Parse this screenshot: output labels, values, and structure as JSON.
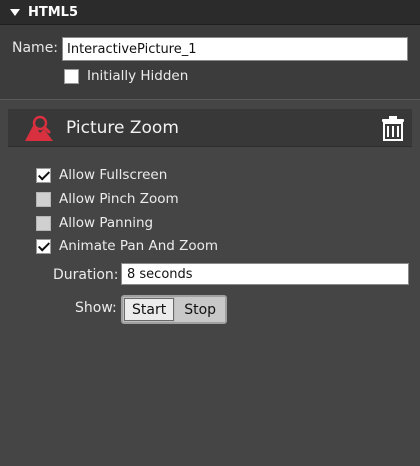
{
  "header": {
    "title": "HTML5"
  },
  "name_row": {
    "label": "Name:",
    "value": "InteractivePicture_1"
  },
  "initially_hidden": {
    "label": "Initially Hidden",
    "checked": false
  },
  "panel": {
    "title": "Picture Zoom",
    "icon": "picture-zoom-icon",
    "icon_color": "#d9303f"
  },
  "options": [
    {
      "label": "Allow Fullscreen",
      "checked": true,
      "enabled": true
    },
    {
      "label": "Allow Pinch Zoom",
      "checked": false,
      "enabled": false
    },
    {
      "label": "Allow Panning",
      "checked": false,
      "enabled": false
    },
    {
      "label": "Animate Pan And Zoom",
      "checked": true,
      "enabled": true
    }
  ],
  "duration": {
    "label": "Duration:",
    "value": "8 seconds"
  },
  "show": {
    "label": "Show:",
    "options": [
      "Start",
      "Stop"
    ],
    "selected": "Start"
  }
}
